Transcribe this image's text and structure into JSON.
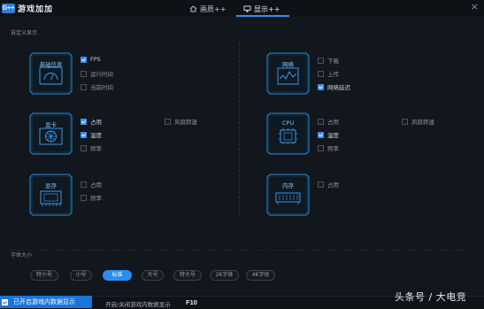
{
  "app": {
    "logo_badge": "G++",
    "title": "游戏加加"
  },
  "tabs": [
    {
      "label": "画质++",
      "icon": "home-icon",
      "active": false
    },
    {
      "label": "显示++",
      "icon": "monitor-icon",
      "active": true
    }
  ],
  "window": {
    "close_label": "×"
  },
  "custom_display": {
    "section_label": "自定义显示",
    "cards": {
      "system": {
        "title": "基础信息",
        "icon": "gauge-icon",
        "options": [
          {
            "label": "FPS",
            "checked": true
          },
          {
            "label": "运行时间",
            "checked": false
          },
          {
            "label": "当前时间",
            "checked": false
          }
        ]
      },
      "network": {
        "title": "网络",
        "icon": "network-chart-icon",
        "options": [
          {
            "label": "下载",
            "checked": false
          },
          {
            "label": "上传",
            "checked": false
          },
          {
            "label": "网络延迟",
            "checked": true
          }
        ]
      },
      "gpu": {
        "title": "显卡",
        "icon": "gpu-fan-icon",
        "options": [
          {
            "label": "占用",
            "checked": true
          },
          {
            "label": "温度",
            "checked": true
          },
          {
            "label": "频率",
            "checked": false
          }
        ],
        "fan_option": {
          "label": "风扇转速",
          "checked": false
        }
      },
      "cpu": {
        "title": "CPU",
        "icon": "cpu-chip-icon",
        "options": [
          {
            "label": "占用",
            "checked": false
          },
          {
            "label": "温度",
            "checked": true
          },
          {
            "label": "频率",
            "checked": false
          }
        ],
        "fan_option": {
          "label": "风扇转速",
          "checked": false
        }
      },
      "vram": {
        "title": "显存",
        "icon": "vram-chip-icon",
        "options": [
          {
            "label": "占用",
            "checked": false
          },
          {
            "label": "频率",
            "checked": false
          }
        ]
      },
      "memory": {
        "title": "内存",
        "icon": "ram-stick-icon",
        "options": [
          {
            "label": "占用",
            "checked": false
          }
        ]
      }
    }
  },
  "font_size": {
    "section_label": "字体大小",
    "options": [
      "特小号",
      "小号",
      "标准",
      "大号",
      "特大号",
      "2K字体",
      "4K字体"
    ],
    "selected": "标准"
  },
  "bottom": {
    "enable_label": "已开启游戏内数据显示",
    "enable_checked": true,
    "hotkey_label": "开启/关闭游戏内数据显示",
    "hotkey": "F10"
  },
  "watermark": "头条号 / 大电竞",
  "colors": {
    "accent": "#2c8df0",
    "background": "#12161d",
    "card_glow": "#1f8fe0"
  }
}
